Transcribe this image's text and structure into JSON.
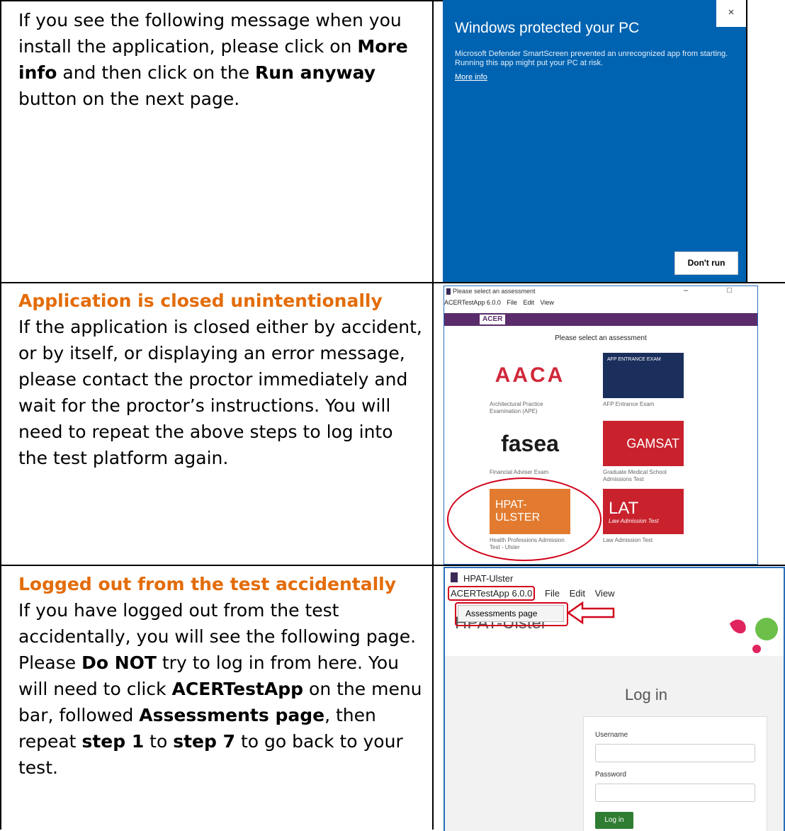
{
  "rows": [
    {
      "heading": "",
      "text_parts": [
        {
          "t": "If you see the following message when you install the application, please click on ",
          "b": false
        },
        {
          "t": "More info",
          "b": true
        },
        {
          "t": " and then click on the ",
          "b": false
        },
        {
          "t": "Run anyway",
          "b": true
        },
        {
          "t": " button on the next page.",
          "b": false
        }
      ]
    },
    {
      "heading": "Application is closed unintentionally",
      "text_parts": [
        {
          "t": "If the application is closed either by accident, or by itself, or displaying an error message, please contact the proctor immediately and wait for the proctor’s instructions. You will need to repeat the above steps to log into the test platform again.",
          "b": false
        }
      ]
    },
    {
      "heading": "Logged out from the test accidentally",
      "text_parts": [
        {
          "t": "If you have logged out from the test accidentally, you will see the following page. Please ",
          "b": false
        },
        {
          "t": "Do NOT",
          "b": true
        },
        {
          "t": " try to log in from here. You will need to click ",
          "b": false
        },
        {
          "t": "ACERTestApp",
          "b": true
        },
        {
          "t": " on the menu bar, followed ",
          "b": false
        },
        {
          "t": "Assessments page",
          "b": true
        },
        {
          "t": ", then repeat ",
          "b": false
        },
        {
          "t": "step 1",
          "b": true
        },
        {
          "t": " to ",
          "b": false
        },
        {
          "t": "step 7",
          "b": true
        },
        {
          "t": " to go back to your test.",
          "b": false
        }
      ]
    }
  ],
  "smartscreen": {
    "title": "Windows protected your PC",
    "message": "Microsoft Defender SmartScreen prevented an unrecognized app from starting. Running this app might put your PC at risk.",
    "more_info": "More info",
    "close": "×",
    "dont_run": "Don't run",
    "bg_color": "#0063b1"
  },
  "assessments": {
    "window_title": "Please select an assessment",
    "window_controls": "– □",
    "menu": [
      "ACERTestApp 6.0.0",
      "File",
      "Edit",
      "View"
    ],
    "logo": "ACER",
    "prompt": "Please select an assessment",
    "tiles": [
      {
        "logo": "AACA",
        "caption": "Architectural Practice Examination (APE)"
      },
      {
        "logo": "AFP ENTRANCE EXAM",
        "caption": "AFP Entrance Exam"
      },
      {
        "logo": "fasea",
        "caption": "Financial Adviser Exam"
      },
      {
        "logo": "GAMSAT",
        "caption": "Graduate Medical School Admissions Test"
      },
      {
        "logo": "HPAT-ULSTER",
        "caption": "Health Professions Admission Test - Ulster"
      },
      {
        "logo": "LAT",
        "logo_sub": "Law Admission Test",
        "caption": "Law Admission Test"
      }
    ]
  },
  "login_page": {
    "window_title": "HPAT-Ulster",
    "menu": [
      "ACERTestApp 6.0.0",
      "File",
      "Edit",
      "View"
    ],
    "dropdown_item": "Assessments page",
    "page_title": "HPAT-Ulster",
    "login_title": "Log in",
    "username_label": "Username",
    "password_label": "Password",
    "login_button": "Log in"
  }
}
